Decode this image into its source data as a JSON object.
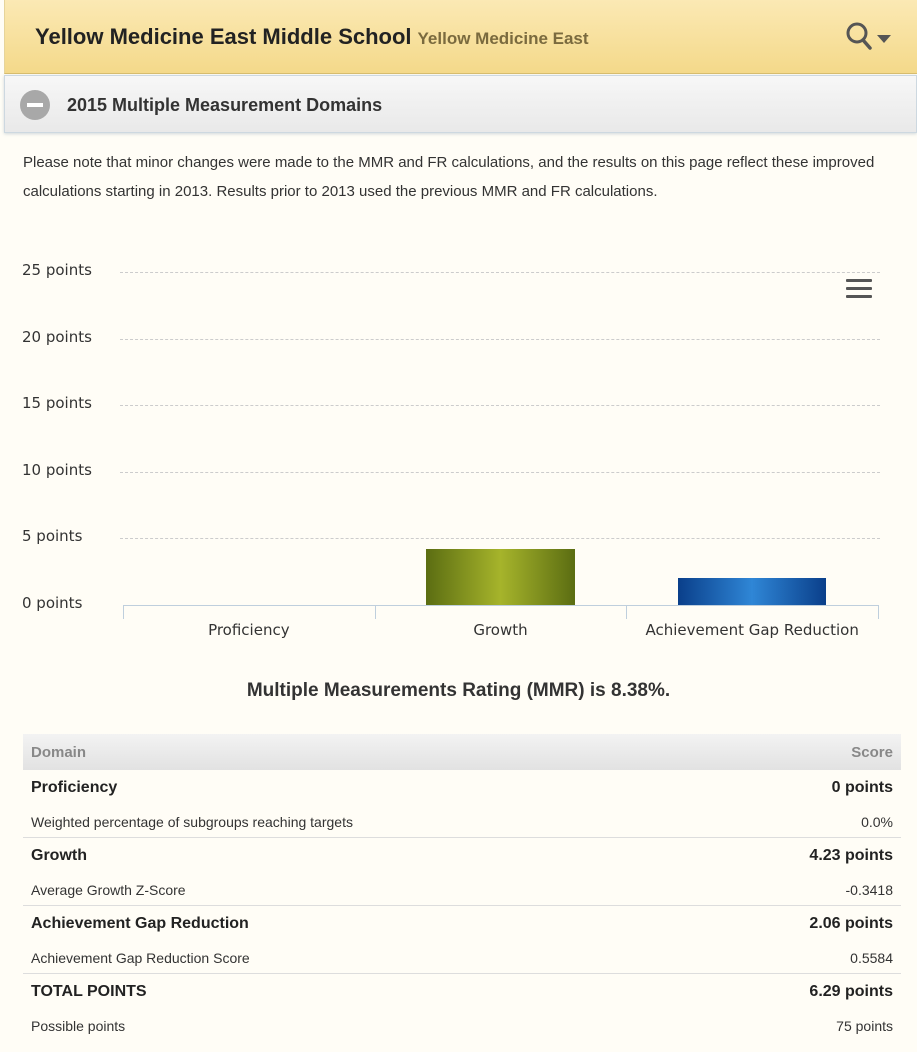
{
  "header": {
    "school_name": "Yellow Medicine East Middle School",
    "district_name": "Yellow Medicine East"
  },
  "section": {
    "title": "2015 Multiple Measurement Domains"
  },
  "note": "Please note that minor changes were made to the MMR and FR calculations, and the results on this page reflect these improved calculations starting in 2013. Results prior to 2013 used the previous MMR and FR calculations.",
  "chart_data": {
    "type": "bar",
    "categories": [
      "Proficiency",
      "Growth",
      "Achievement Gap Reduction"
    ],
    "values": [
      0,
      4.23,
      2.06
    ],
    "y_ticks": [
      "25 points",
      "20 points",
      "15 points",
      "10 points",
      "5 points",
      "0 points"
    ],
    "ylim": [
      0,
      25
    ],
    "grid": true,
    "bar_colors": [
      "#a6b42b",
      "#a6b42b",
      "#2f86d6"
    ],
    "xlabel": "",
    "ylabel": ""
  },
  "mmr_text": "Multiple Measurements Rating (MMR) is 8.38%.",
  "table": {
    "headers": {
      "domain": "Domain",
      "score": "Score"
    },
    "rows": [
      {
        "label": "Proficiency",
        "value": "0 points",
        "sub_label": "Weighted percentage of subgroups reaching targets",
        "sub_value": "0.0%"
      },
      {
        "label": "Growth",
        "value": "4.23 points",
        "sub_label": "Average Growth Z-Score",
        "sub_value": "-0.3418"
      },
      {
        "label": "Achievement Gap Reduction",
        "value": "2.06 points",
        "sub_label": "Achievement Gap Reduction Score",
        "sub_value": "0.5584"
      },
      {
        "label": "TOTAL POINTS",
        "value": "6.29 points",
        "sub_label": "Possible points",
        "sub_value": "75 points"
      }
    ]
  }
}
